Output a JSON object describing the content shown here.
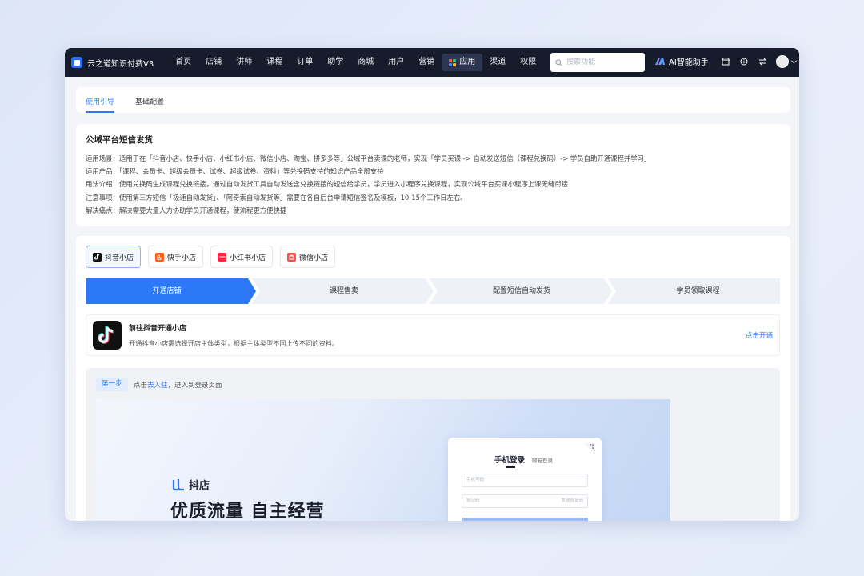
{
  "app": {
    "title": "云之道知识付费V3"
  },
  "nav": {
    "items": [
      {
        "label": "首页"
      },
      {
        "label": "店铺"
      },
      {
        "label": "讲师"
      },
      {
        "label": "课程"
      },
      {
        "label": "订单"
      },
      {
        "label": "助学"
      },
      {
        "label": "商城"
      },
      {
        "label": "用户"
      },
      {
        "label": "营销"
      },
      {
        "label": "应用",
        "active": true
      },
      {
        "label": "渠道"
      },
      {
        "label": "权限"
      }
    ],
    "search_placeholder": "搜索功能",
    "ai_label": "AI智能助手",
    "icons": [
      "store-icon",
      "info-icon",
      "switch-icon",
      "avatar",
      "chevron-down-icon"
    ]
  },
  "tabs": [
    {
      "label": "使用引导",
      "active": true
    },
    {
      "label": "基础配置",
      "active": false
    }
  ],
  "info": {
    "title": "公域平台短信发货",
    "lines": [
      "适用场景：适用于在「抖音小店、快手小店、小红书小店、微信小店、淘宝、拼多多等」公域平台卖课的老师，实现「学员买课 -> 自动发送短信（课程兑换码）-> 学员自助开通课程并学习」",
      "适用产品：「课程、会员卡、超级会员卡、试卷、超级试卷、资料」等兑换码支持的知识产品全部支持",
      "用法介绍：使用兑换码生成课程兑换链接，通过自动发货工具自动发送含兑换链接的短信给学员，学员进入小程序兑换课程，实现公域平台买课小程序上课无缝衔接",
      "注意事项：使用第三方短信「极速自动发货」、「阿奇索自动发货等」需要在各自后台申请短信签名及模板，10-15个工作日左右。",
      "解决痛点：解决需要大量人力协助学员开通课程，使流程更方便快捷"
    ]
  },
  "platforms": [
    {
      "label": "抖音小店",
      "icon": "douyin-icon",
      "color": "#111111",
      "active": true
    },
    {
      "label": "快手小店",
      "icon": "kuaishou-icon",
      "color": "#ff5a1f",
      "active": false
    },
    {
      "label": "小红书小店",
      "icon": "xiaohongshu-icon",
      "color": "#ff2442",
      "active": false
    },
    {
      "label": "微信小店",
      "icon": "wechat-store-icon",
      "color": "#fa5151",
      "active": false
    }
  ],
  "steps": [
    {
      "label": "开通店铺",
      "active": true
    },
    {
      "label": "课程售卖",
      "active": false
    },
    {
      "label": "配置短信自动发货",
      "active": false
    },
    {
      "label": "学员领取课程",
      "active": false
    }
  ],
  "open_store": {
    "title": "前往抖音开通小店",
    "desc": "开通抖音小店需选择开店主体类型，根据主体类型不同上传不同的资料。",
    "link": "点击开通"
  },
  "guide": {
    "step_tag": "第一步",
    "text_prefix": "点击",
    "text_link": "去入驻",
    "text_suffix": "，进入到登录页面",
    "preview": {
      "brand": "抖店",
      "slogan": "优质流量 自主经营",
      "login_tab_main": "手机登录",
      "login_tab_sub": "邮箱登录",
      "phone_placeholder": "手机号码",
      "code_placeholder": "验证码",
      "send_code": "发送验证码"
    }
  },
  "colors": {
    "accent": "#2c78f6",
    "nav_bg": "#161c2b"
  }
}
